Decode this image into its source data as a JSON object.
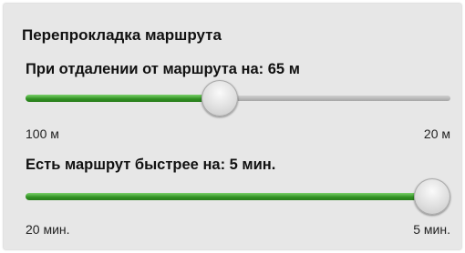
{
  "title": "Перепрокладка маршрута",
  "distance_setting": {
    "label": "При отдалении от маршрута на: 65 м",
    "min_label": "100 м",
    "max_label": "20 м",
    "level_fraction": 0.453
  },
  "faster_route_setting": {
    "label": "Есть маршрут быстрее на: 5 мин.",
    "min_label": "20 мин.",
    "max_label": "5 мин.",
    "level_fraction": 1.0
  },
  "colors": {
    "track_fill": "#2f8f21",
    "track_empty": "#b8b8b8",
    "panel_background": "#e7e7e7"
  }
}
